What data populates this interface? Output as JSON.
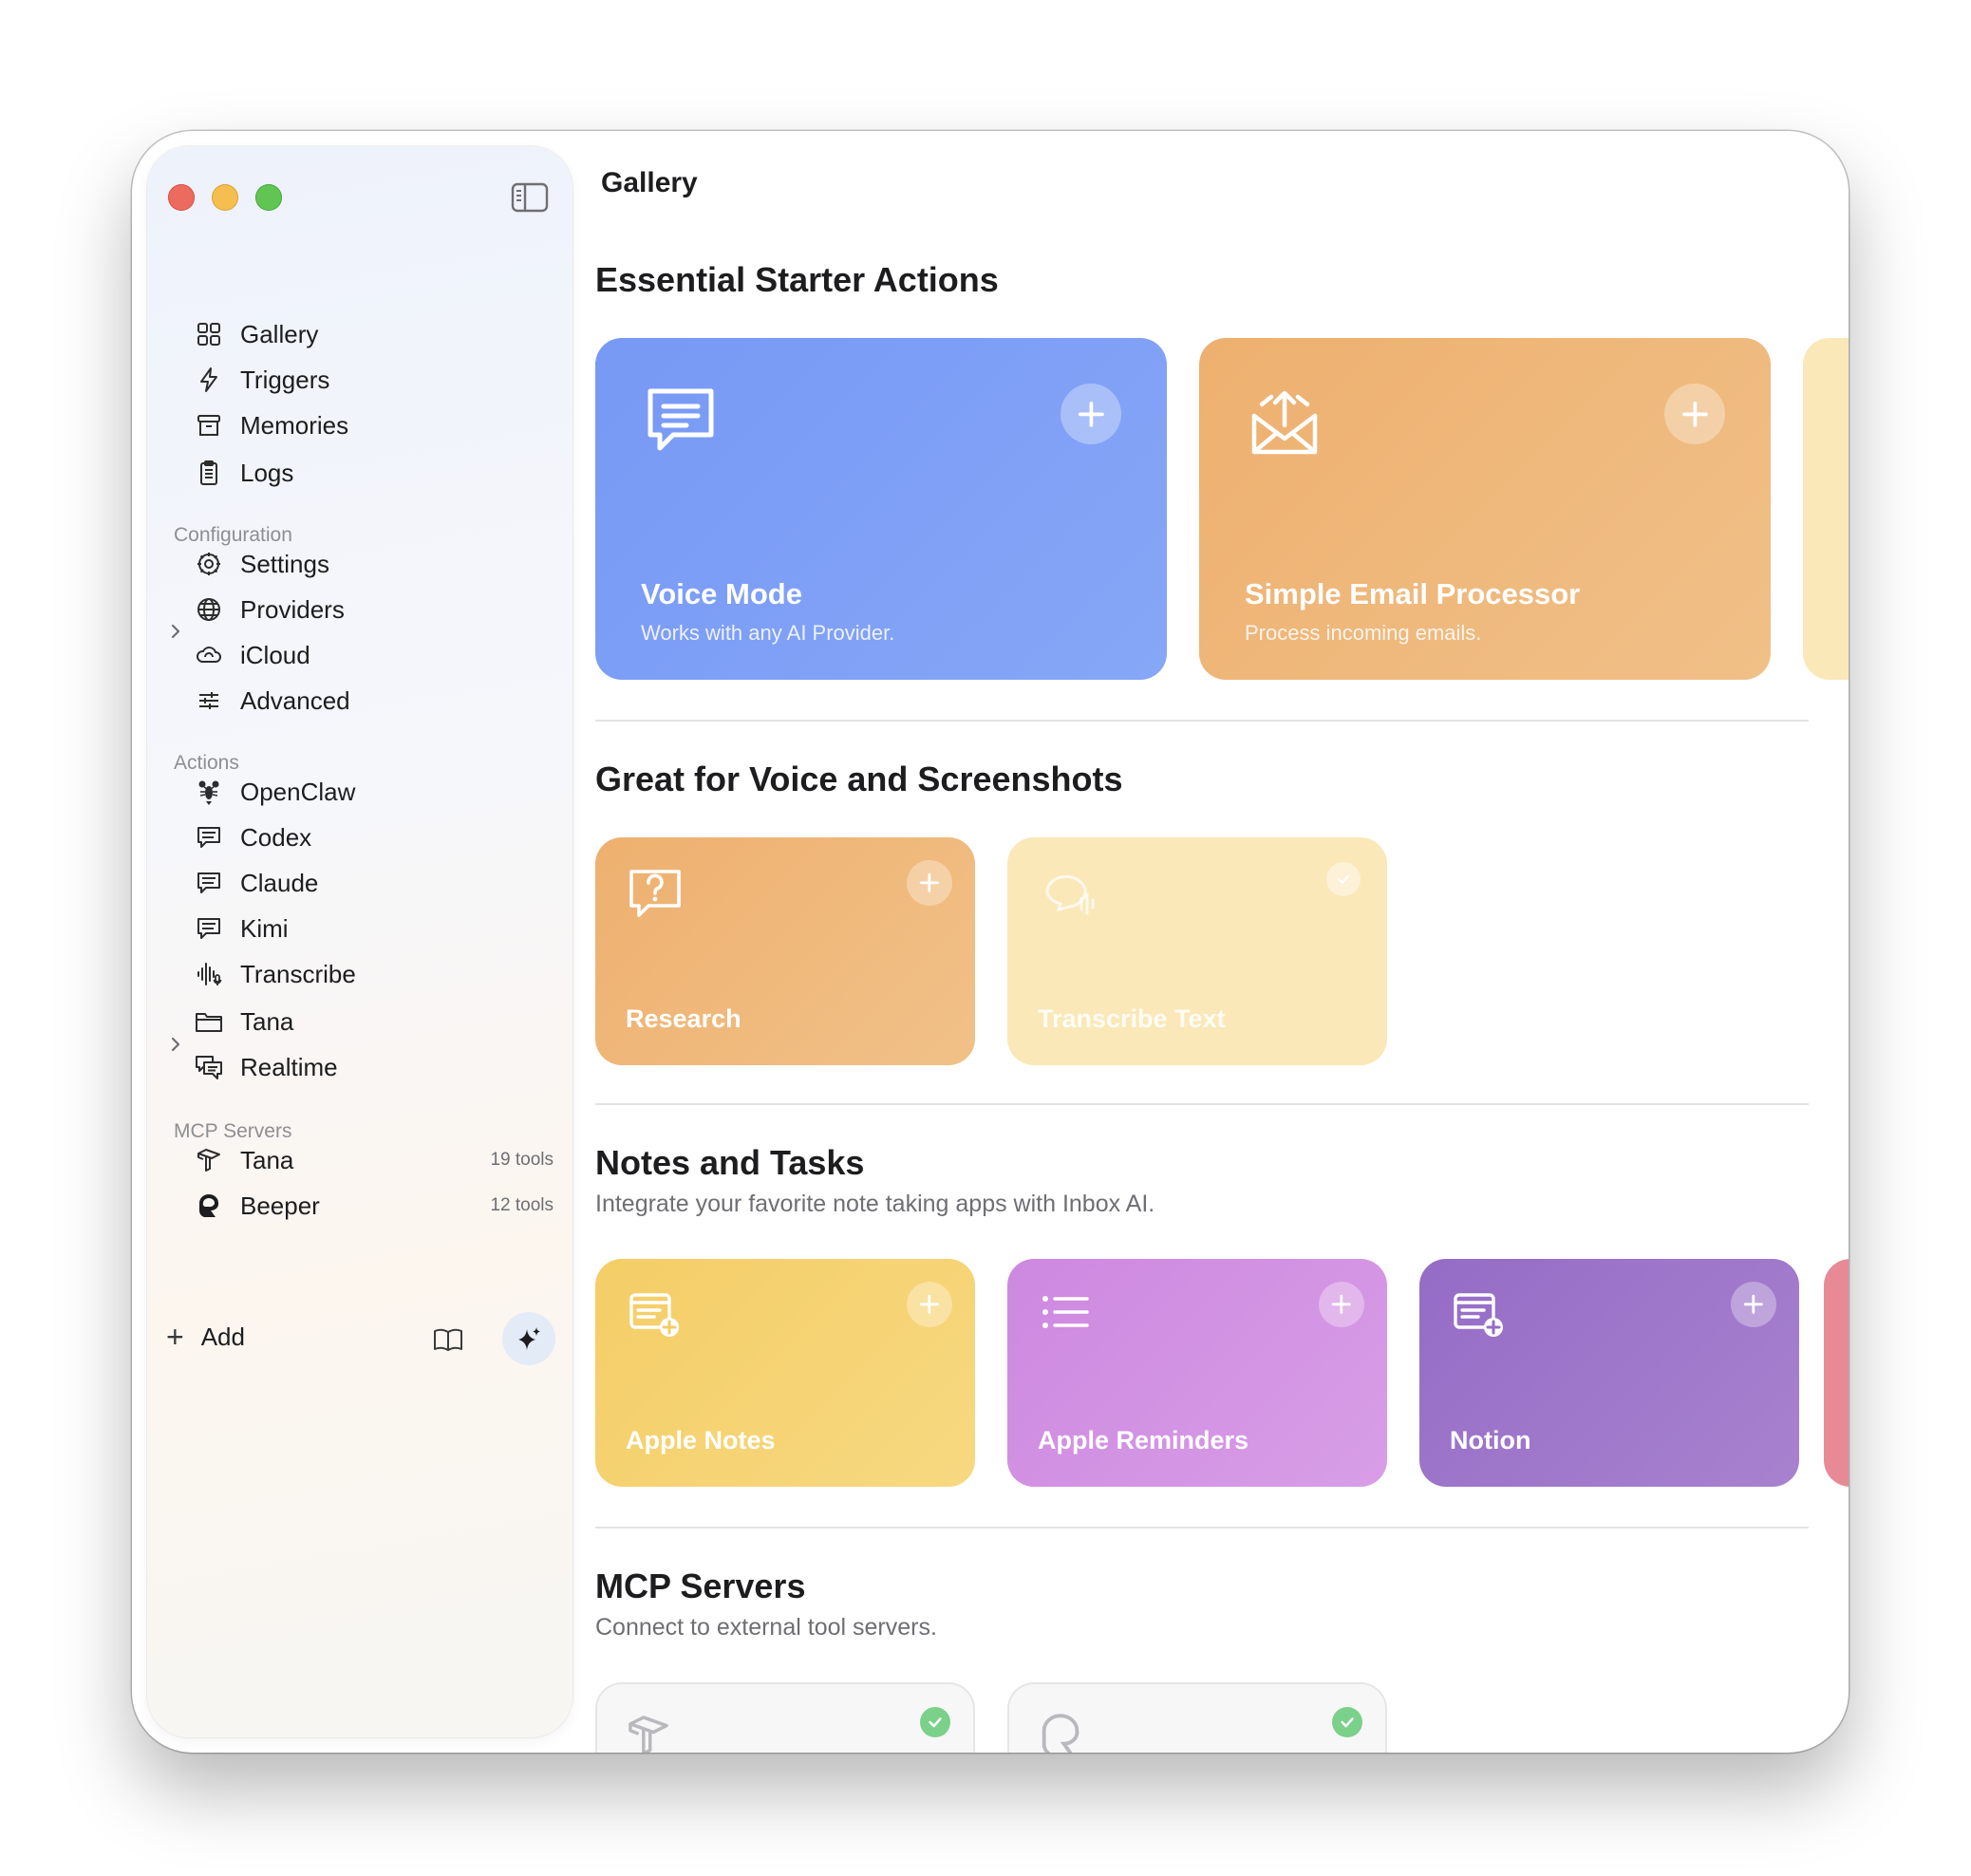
{
  "window": {
    "title": "Gallery"
  },
  "sidebar": {
    "main_items": [
      {
        "label": "Gallery",
        "icon": "grid-icon"
      },
      {
        "label": "Triggers",
        "icon": "bolt-icon"
      },
      {
        "label": "Memories",
        "icon": "archive-box-icon"
      },
      {
        "label": "Logs",
        "icon": "clipboard-list-icon"
      }
    ],
    "configuration_label": "Configuration",
    "configuration_items": [
      {
        "label": "Settings",
        "icon": "gear-icon"
      },
      {
        "label": "Providers",
        "icon": "globe-icon"
      },
      {
        "label": "iCloud",
        "icon": "icloud-icon"
      },
      {
        "label": "Advanced",
        "icon": "sliders-icon"
      }
    ],
    "actions_label": "Actions",
    "actions_items": [
      {
        "label": "OpenClaw",
        "icon": "lobster-icon"
      },
      {
        "label": "Codex",
        "icon": "chat-bubble-icon"
      },
      {
        "label": "Claude",
        "icon": "chat-bubble-icon"
      },
      {
        "label": "Kimi",
        "icon": "chat-bubble-icon"
      },
      {
        "label": "Transcribe",
        "icon": "waveform-mic-icon"
      },
      {
        "label": "Tana",
        "icon": "folder-icon"
      },
      {
        "label": "Realtime",
        "icon": "chat-bubbles-icon"
      }
    ],
    "mcp_label": "MCP Servers",
    "mcp_items": [
      {
        "label": "Tana",
        "tools": "19 tools",
        "icon": "tana-logo-icon"
      },
      {
        "label": "Beeper",
        "tools": "12 tools",
        "icon": "beeper-logo-icon"
      }
    ],
    "add_label": "Add"
  },
  "gallery": {
    "essential": {
      "title": "Essential Starter Actions",
      "cards": [
        {
          "title": "Voice Mode",
          "description": "Works with any AI Provider.",
          "color": "#7a9cf5"
        },
        {
          "title": "Simple Email Processor",
          "description": "Process incoming emails.",
          "color": "#eeb271"
        }
      ]
    },
    "voice": {
      "title": "Great for Voice and Screenshots",
      "cards": [
        {
          "title": "Research",
          "color": "#eeb777"
        },
        {
          "title": "Transcribe Text",
          "color": "#fbe8b8"
        }
      ]
    },
    "notes": {
      "title": "Notes and Tasks",
      "subtitle": "Integrate your favorite note taking apps with Inbox AI.",
      "cards": [
        {
          "title": "Apple Notes",
          "color": "#f5d06c"
        },
        {
          "title": "Apple Reminders",
          "color": "#cf8fe0"
        },
        {
          "title": "Notion",
          "color": "#9a72c8"
        }
      ]
    },
    "mcp": {
      "title": "MCP Servers",
      "subtitle": "Connect to external tool servers."
    }
  }
}
